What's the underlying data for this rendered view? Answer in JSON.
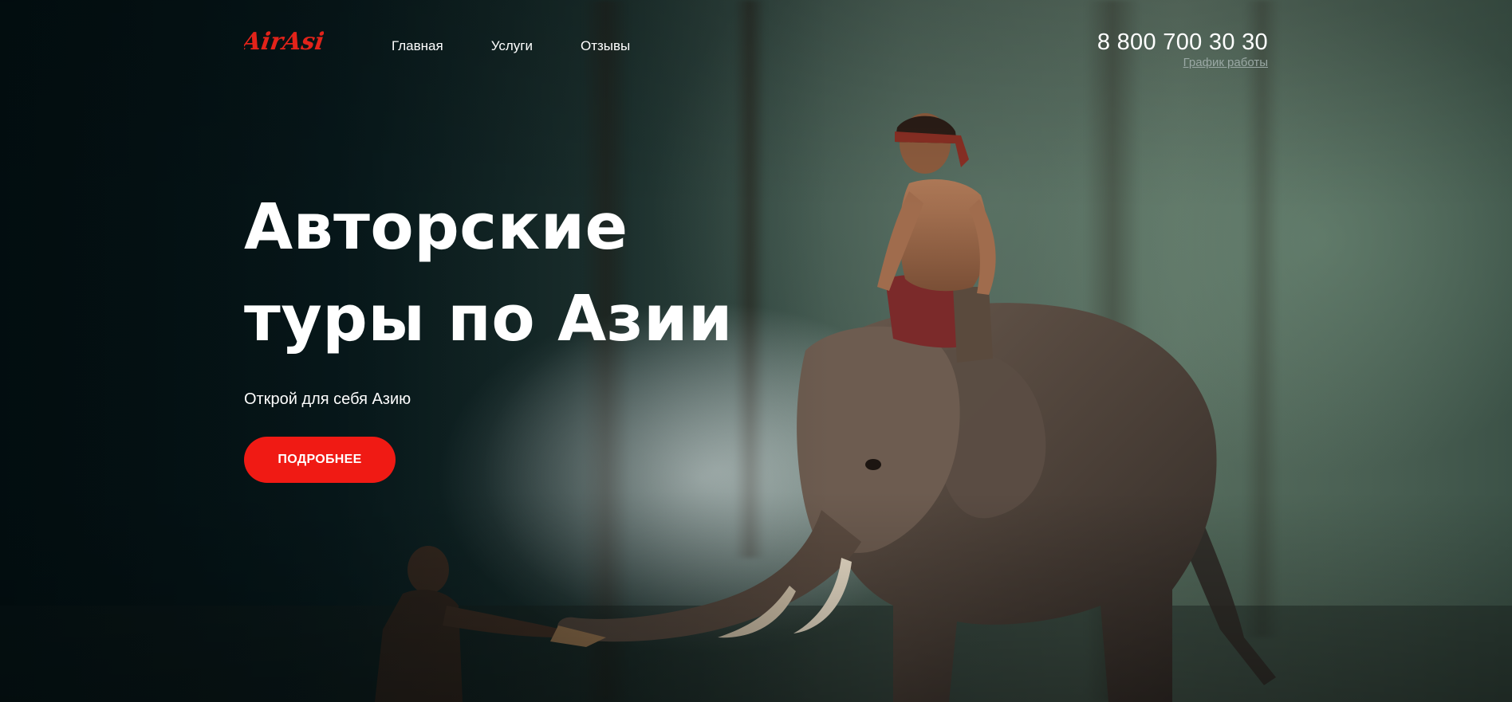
{
  "brand": {
    "logo_text": "AirAsia",
    "accent_color": "#f01a14"
  },
  "nav": {
    "items": [
      {
        "label": "Главная"
      },
      {
        "label": "Услуги"
      },
      {
        "label": "Отзывы"
      }
    ]
  },
  "contacts": {
    "phone": "8 800 700 30 30",
    "schedule_link": "График работы"
  },
  "hero": {
    "title_line1": "Авторские",
    "title_line2": "туры по Азии",
    "subtitle": "Открой для себя Азию",
    "button_label": "ПОДРОБНЕЕ"
  }
}
